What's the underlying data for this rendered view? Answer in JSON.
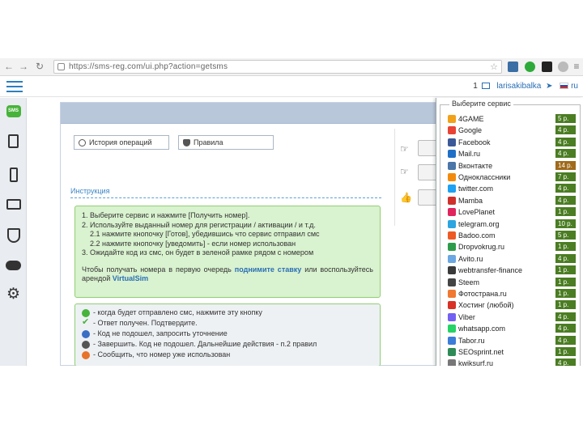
{
  "browser": {
    "url": "https://sms-reg.com/ui.php?action=getsms"
  },
  "header": {
    "counter": "1",
    "username": "larisakibalka",
    "language": "ru"
  },
  "sidebar": {
    "items": [
      "sms-icon",
      "clipboard-icon",
      "phone-icon",
      "wallet-icon",
      "shield-icon",
      "cloud-icon",
      "gear-icon"
    ]
  },
  "tabs": {
    "history": "История операций",
    "rules": "Правила"
  },
  "instructions": {
    "title": "Инструкция",
    "step1": "1. Выберите сервис и нажмите [Получить номер].",
    "step2": "2. Используйте выданный номер для регистрации / активации / и т.д.",
    "step2_1": "2.1 нажмите кнопочку [Готов], убедившись что сервис отправил смс",
    "step2_2": "2.2 нажмите кнопочку [уведомить] - если номер использован",
    "step3": "3. Ожидайте код из смс, он будет в зеленой рамке рядом с номером",
    "queue_pre": "Чтобы получать номера в первую очередь",
    "queue_link": "поднимите ставку",
    "queue_mid": "или воспользуйтесь арендой",
    "queue_link2": "VirtualSim"
  },
  "legend": [
    {
      "icon": "sms-icon",
      "text": "- когда будет отправлено смс, нажмите эту кнопку"
    },
    {
      "icon": "check-icon",
      "text": "- Ответ получен. Подтвердите."
    },
    {
      "icon": "refresh-icon",
      "text": "- Код не подошел, запросить уточнение"
    },
    {
      "icon": "complete-icon",
      "text": "- Завершить. Код не подошел. Дальнейшие действия - п.2 правил"
    },
    {
      "icon": "warning-icon",
      "text": "- Сообщить, что номер уже использован"
    }
  ],
  "service_panel": {
    "title": "Выберите сервис",
    "services": [
      {
        "name": "4GAME",
        "price": "5 р.",
        "color": "#f2a11a"
      },
      {
        "name": "Google",
        "price": "4 р.",
        "color": "#e84335"
      },
      {
        "name": "Facebook",
        "price": "4 р.",
        "color": "#3b5998"
      },
      {
        "name": "Mail.ru",
        "price": "4 р.",
        "color": "#1f6fc7"
      },
      {
        "name": "Вконтакте",
        "price": "14 р.",
        "color": "#4a76a8",
        "hi": true
      },
      {
        "name": "Одноклассники",
        "price": "7 р.",
        "color": "#f28b0c"
      },
      {
        "name": "twitter.com",
        "price": "4 р.",
        "color": "#1da1f2"
      },
      {
        "name": "Mamba",
        "price": "4 р.",
        "color": "#d0302c"
      },
      {
        "name": "LovePlanet",
        "price": "1 р.",
        "color": "#e0245e"
      },
      {
        "name": "telegram.org",
        "price": "10 р.",
        "color": "#2ca5e0"
      },
      {
        "name": "Badoo.com",
        "price": "5 р.",
        "color": "#ee5a24"
      },
      {
        "name": "Dropvokrug.ru",
        "price": "1 р.",
        "color": "#2d9c4a"
      },
      {
        "name": "Avito.ru",
        "price": "4 р.",
        "color": "#6aa7e3"
      },
      {
        "name": "webtransfer-finance",
        "price": "1 р.",
        "color": "#3a3a3a"
      },
      {
        "name": "Steem",
        "price": "1 р.",
        "color": "#444444"
      },
      {
        "name": "Фотострана.ru",
        "price": "1 р.",
        "color": "#f07830"
      },
      {
        "name": "Хостинг (любой)",
        "price": "1 р.",
        "color": "#d93025"
      },
      {
        "name": "Viber",
        "price": "4 р.",
        "color": "#7360f2"
      },
      {
        "name": "whatsapp.com",
        "price": "4 р.",
        "color": "#25d366"
      },
      {
        "name": "Tabor.ru",
        "price": "4 р.",
        "color": "#3b7dd8"
      },
      {
        "name": "SEOsprint.net",
        "price": "1 р.",
        "color": "#2e8b57"
      },
      {
        "name": "kwiksurf.ru",
        "price": "4 р.",
        "color": "#777777"
      }
    ]
  }
}
